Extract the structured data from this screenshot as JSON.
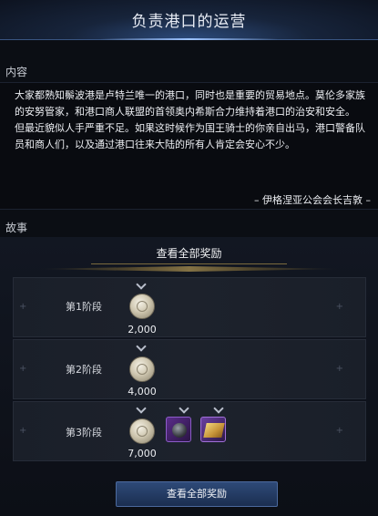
{
  "header": {
    "title": "负责港口的运营"
  },
  "content_section": {
    "label": "内容"
  },
  "description": {
    "paragraph1": "大家都熟知鬃波港是卢特兰唯一的港口，同时也是重要的贸易地点。莫伦多家族的安努管家，和港口商人联盟的首领奥内希斯合力维持着港口的治安和安全。",
    "paragraph2": "但最近貌似人手严重不足。如果这时候作为国王骑士的你亲自出马，港口警备队员和商人们，以及通过港口往来大陆的所有人肯定会安心不少。",
    "signature": "– 伊格涅亚公会会长吉敦 –"
  },
  "story_section": {
    "label": "故事"
  },
  "rewards": {
    "view_all_top_label": "查看全部奖励",
    "view_all_button_label": "查看全部奖励",
    "stages": [
      {
        "label": "第1阶段",
        "coin_amount": "2,000"
      },
      {
        "label": "第2阶段",
        "coin_amount": "4,000"
      },
      {
        "label": "第3阶段",
        "coin_amount": "7,000"
      }
    ]
  },
  "icons": {
    "coin": "silver-coin-icon",
    "orb": "cannonball-icon",
    "map": "treasure-map-icon",
    "diamond": "chevron-down-icon"
  },
  "colors": {
    "accent_gold": "#b59a54",
    "button_blue": "#2e4a78",
    "epic_purple": "#8c5cc8"
  }
}
